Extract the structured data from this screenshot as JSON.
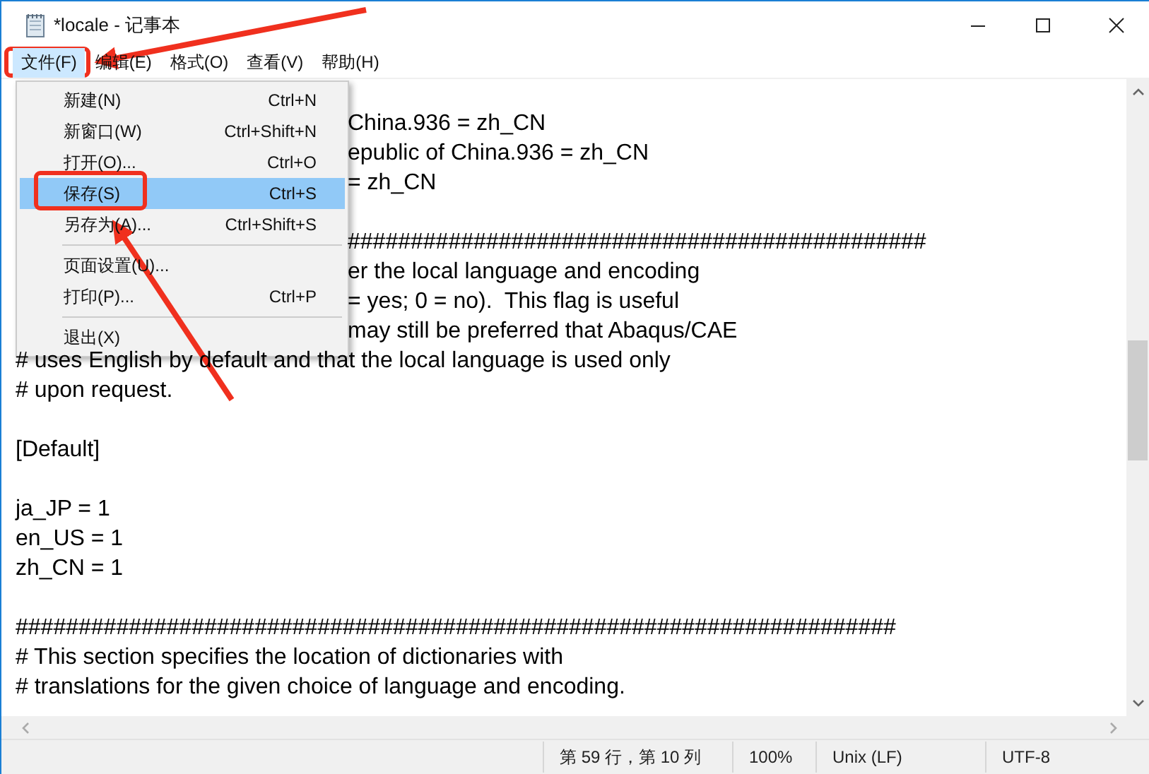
{
  "window": {
    "title": "*locale - 记事本"
  },
  "menu_bar": [
    {
      "label": "文件(F)",
      "selected": true
    },
    {
      "label": "编辑(E)",
      "selected": false
    },
    {
      "label": "格式(O)",
      "selected": false
    },
    {
      "label": "查看(V)",
      "selected": false
    },
    {
      "label": "帮助(H)",
      "selected": false
    }
  ],
  "file_menu": [
    {
      "kind": "item",
      "label": "新建(N)",
      "shortcut": "Ctrl+N",
      "selected": false
    },
    {
      "kind": "item",
      "label": "新窗口(W)",
      "shortcut": "Ctrl+Shift+N",
      "selected": false
    },
    {
      "kind": "item",
      "label": "打开(O)...",
      "shortcut": "Ctrl+O",
      "selected": false
    },
    {
      "kind": "item",
      "label": "保存(S)",
      "shortcut": "Ctrl+S",
      "selected": true
    },
    {
      "kind": "item",
      "label": "另存为(A)...",
      "shortcut": "Ctrl+Shift+S",
      "selected": false
    },
    {
      "kind": "separator"
    },
    {
      "kind": "item",
      "label": "页面设置(U)...",
      "selected": false
    },
    {
      "kind": "item",
      "label": "打印(P)...",
      "shortcut": "Ctrl+P",
      "selected": false
    },
    {
      "kind": "separator"
    },
    {
      "kind": "item",
      "label": "退出(X)",
      "selected": false
    }
  ],
  "editor": {
    "lines": [
      {
        "kind": "covered",
        "text": "China.936 = zh_CN"
      },
      {
        "kind": "covered",
        "text": "epublic of China.936 = zh_CN"
      },
      {
        "kind": "covered",
        "text": "= zh_CN"
      },
      {
        "kind": "blank"
      },
      {
        "kind": "covered",
        "text": "##############################################"
      },
      {
        "kind": "covered",
        "text": "er the local language and encoding"
      },
      {
        "kind": "covered",
        "text": "= yes; 0 = no).  This flag is useful"
      },
      {
        "kind": "covered",
        "text": "may still be preferred that Abaqus/CAE"
      },
      {
        "kind": "full",
        "text": "# uses English by default and that the local language is used only"
      },
      {
        "kind": "full",
        "text": "# upon request."
      },
      {
        "kind": "blank"
      },
      {
        "kind": "full",
        "text": "[Default]"
      },
      {
        "kind": "blank"
      },
      {
        "kind": "full",
        "text": "ja_JP = 1"
      },
      {
        "kind": "full",
        "text": "en_US = 1"
      },
      {
        "kind": "full",
        "text": "zh_CN = 1"
      },
      {
        "kind": "blank"
      },
      {
        "kind": "full",
        "text": "######################################################################"
      },
      {
        "kind": "full",
        "text": "# This section specifies the location of dictionaries with"
      },
      {
        "kind": "full",
        "text": "# translations for the given choice of language and encoding."
      }
    ]
  },
  "status_bar": [
    "第 59 行，第 10 列",
    "100%",
    "Unix (LF)",
    "UTF-8"
  ]
}
